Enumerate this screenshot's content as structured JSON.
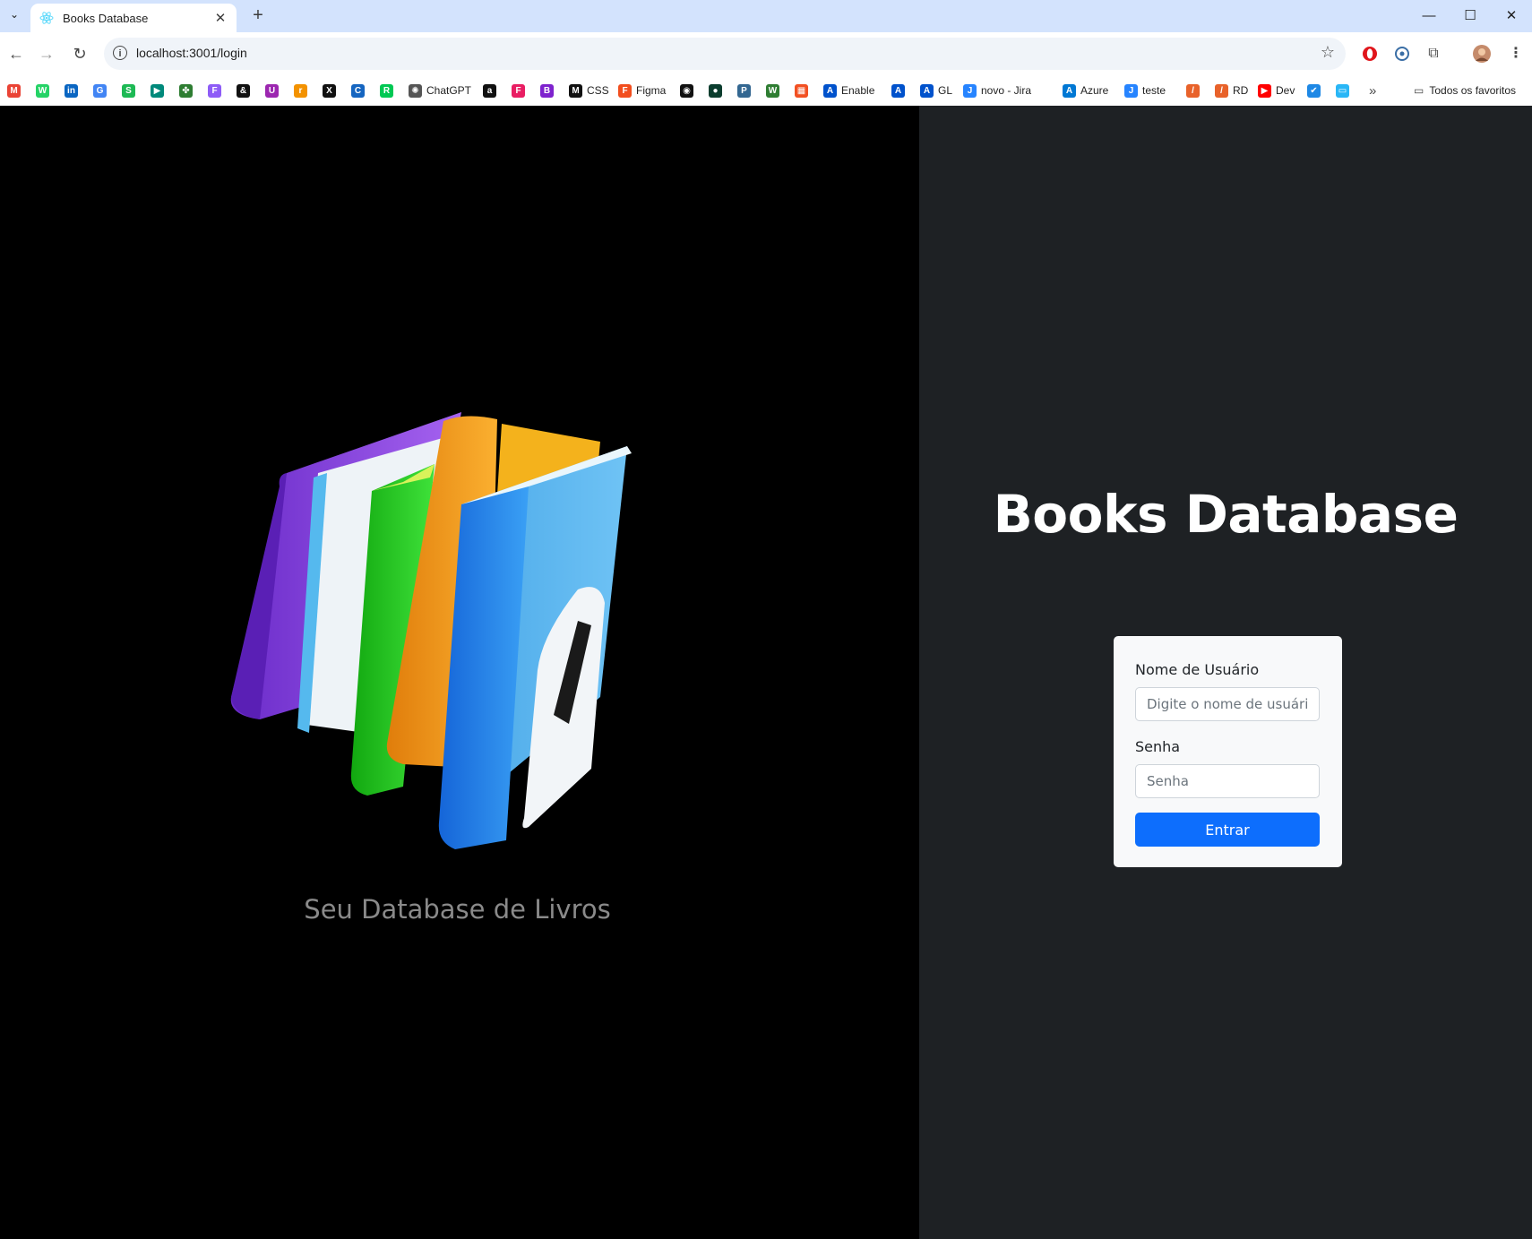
{
  "browser": {
    "tab_title": "Books Database",
    "url": "localhost:3001/login",
    "bookmarks": [
      {
        "label": "",
        "icon": "gmail-icon",
        "color": "#ea4335",
        "glyph": "M"
      },
      {
        "label": "",
        "icon": "whatsapp-icon",
        "color": "#25d366",
        "glyph": "W"
      },
      {
        "label": "",
        "icon": "linkedin-icon",
        "color": "#0a66c2",
        "glyph": "in"
      },
      {
        "label": "",
        "icon": "translate-icon",
        "color": "#4285f4",
        "glyph": "G"
      },
      {
        "label": "",
        "icon": "spotify-icon",
        "color": "#1db954",
        "glyph": "S"
      },
      {
        "label": "",
        "icon": "meet-icon",
        "color": "#00897b",
        "glyph": "▶"
      },
      {
        "label": "",
        "icon": "clover-icon",
        "color": "#2e7d32",
        "glyph": "✤"
      },
      {
        "label": "",
        "icon": "ff-icon",
        "color": "#8e5cf7",
        "glyph": "F"
      },
      {
        "label": "",
        "icon": "ampersand-icon",
        "color": "#111111",
        "glyph": "&"
      },
      {
        "label": "",
        "icon": "u-icon",
        "color": "#9c27b0",
        "glyph": "U"
      },
      {
        "label": "",
        "icon": "rtve-icon",
        "color": "#f39200",
        "glyph": "r"
      },
      {
        "label": "",
        "icon": "x-icon",
        "color": "#111111",
        "glyph": "X"
      },
      {
        "label": "",
        "icon": "c-icon",
        "color": "#1565c0",
        "glyph": "C"
      },
      {
        "label": "",
        "icon": "rc-icon",
        "color": "#00c853",
        "glyph": "R"
      },
      {
        "label": "ChatGPT",
        "icon": "chatgpt-icon",
        "color": "#555555",
        "glyph": "✺"
      },
      {
        "label": "",
        "icon": "a-icon",
        "color": "#111111",
        "glyph": "a"
      },
      {
        "label": "",
        "icon": "f-icon",
        "color": "#e91e63",
        "glyph": "F"
      },
      {
        "label": "",
        "icon": "b-icon",
        "color": "#7e22ce",
        "glyph": "B"
      },
      {
        "label": "CSS",
        "icon": "css-icon",
        "color": "#111111",
        "glyph": "M"
      },
      {
        "label": "Figma",
        "icon": "figma-icon",
        "color": "#f24e1e",
        "glyph": "F"
      },
      {
        "label": "",
        "icon": "github-icon",
        "color": "#111111",
        "glyph": "◉"
      },
      {
        "label": "",
        "icon": "mongodb-icon",
        "color": "#0b3d2e",
        "glyph": "●"
      },
      {
        "label": "",
        "icon": "postgres-icon",
        "color": "#336791",
        "glyph": "P"
      },
      {
        "label": "",
        "icon": "w-icon",
        "color": "#2e7d32",
        "glyph": "W"
      },
      {
        "label": "",
        "icon": "microsoft-icon",
        "color": "#f25022",
        "glyph": "▦"
      },
      {
        "label": "Enable",
        "icon": "atlassian-icon",
        "color": "#0052cc",
        "glyph": "A"
      },
      {
        "label": "",
        "icon": "atlassian-icon",
        "color": "#0052cc",
        "glyph": "A"
      },
      {
        "label": "GL",
        "icon": "atlassian-icon",
        "color": "#0052cc",
        "glyph": "A"
      },
      {
        "label": "novo - Jira",
        "icon": "jira-icon",
        "color": "#2684ff",
        "glyph": "J"
      },
      {
        "label": "Azure",
        "icon": "azure-icon",
        "color": "#0078d4",
        "glyph": "A"
      },
      {
        "label": "teste",
        "icon": "jira-icon",
        "color": "#2684ff",
        "glyph": "J"
      },
      {
        "label": "",
        "icon": "slash-icon",
        "color": "#e8622a",
        "glyph": "/"
      },
      {
        "label": "RD",
        "icon": "rd-icon",
        "color": "#e8622a",
        "glyph": "/"
      },
      {
        "label": "Dev",
        "icon": "youtube-icon",
        "color": "#ff0000",
        "glyph": "▶"
      },
      {
        "label": "",
        "icon": "check-icon",
        "color": "#1e88e5",
        "glyph": "✔"
      },
      {
        "label": "",
        "icon": "screen-icon",
        "color": "#29b6f6",
        "glyph": "▭"
      }
    ],
    "all_bookmarks_label": "Todos os favoritos"
  },
  "hero": {
    "tagline": "Seu Database de Livros"
  },
  "login": {
    "title": "Books Database",
    "username_label": "Nome de Usuário",
    "username_placeholder": "Digite o nome de usuário",
    "password_label": "Senha",
    "password_placeholder": "Senha",
    "submit_label": "Entrar"
  },
  "colors": {
    "left_pane": "#000000",
    "right_pane": "#1e2124",
    "card": "#f8f9fa",
    "primary": "#0d6efd"
  }
}
